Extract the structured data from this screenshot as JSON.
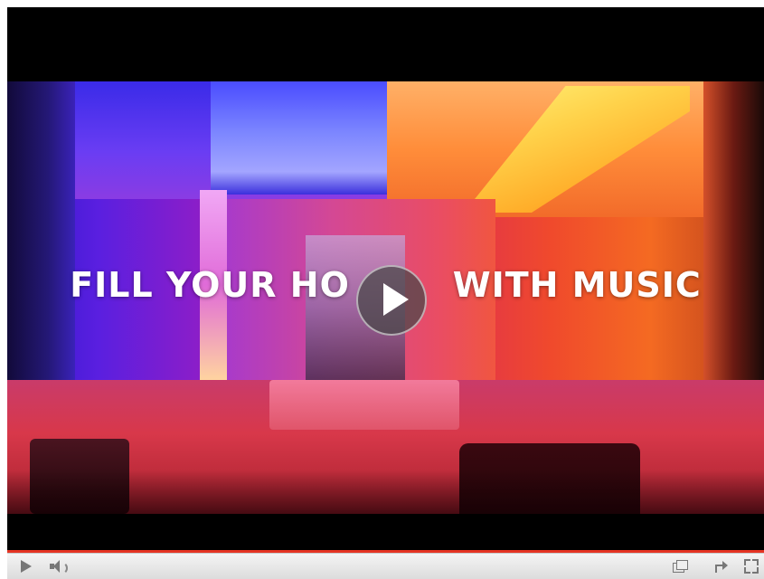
{
  "video": {
    "headline": "FILL YOUR HOME WITH MUSIC",
    "headline_visible": "FILL YOUR HO        WITH MUSIC",
    "progress_played_fraction": 0.0
  },
  "controls": {
    "play_icon": "play-icon",
    "volume_icon": "volume-icon",
    "popout_icon": "popout-icon",
    "share_icon": "share-icon",
    "fullscreen_icon": "fullscreen-icon"
  },
  "colors": {
    "progress": "#e53423",
    "controlbar": "#e8e8e8"
  }
}
